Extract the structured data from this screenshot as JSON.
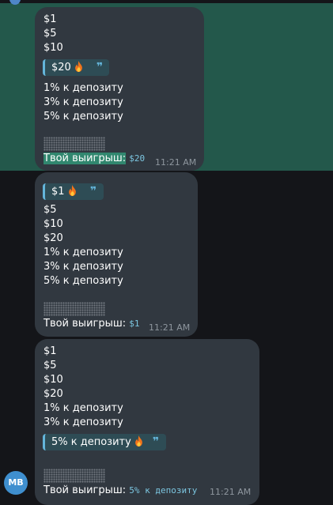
{
  "messages": [
    {
      "options": [
        "$1",
        "$5",
        "$10"
      ],
      "selected": "$20",
      "options_after": [
        "1% к депозиту",
        "3% к депозиту",
        "5% к депозиту"
      ],
      "win_label": "Твой выигрыш:",
      "win_value": "$20",
      "time": "11:21 AM"
    },
    {
      "selected": "$1",
      "options_after": [
        "$5",
        "$10",
        "$20",
        "1% к депозиту",
        "3% к депозиту",
        "5% к депозиту"
      ],
      "win_label": "Твой выигрыш:",
      "win_value": "$1",
      "time": "11:21 AM"
    },
    {
      "options": [
        "$1",
        "$5",
        "$10",
        "$20",
        "1% к депозиту",
        "3% к депозиту"
      ],
      "selected": "5% к депозиту",
      "win_label": "Твой выигрыш:",
      "win_value": "5% к депозиту",
      "time": "11:21 AM"
    }
  ],
  "avatar": {
    "initials": "MB"
  },
  "icons": {
    "selected_marker": "fire-icon",
    "quote_marker": "quote-icon",
    "hidden_text": "spoiler"
  },
  "colors": {
    "bubble": "#313840",
    "highlight": "#23584b",
    "accent": "#64b5da"
  }
}
